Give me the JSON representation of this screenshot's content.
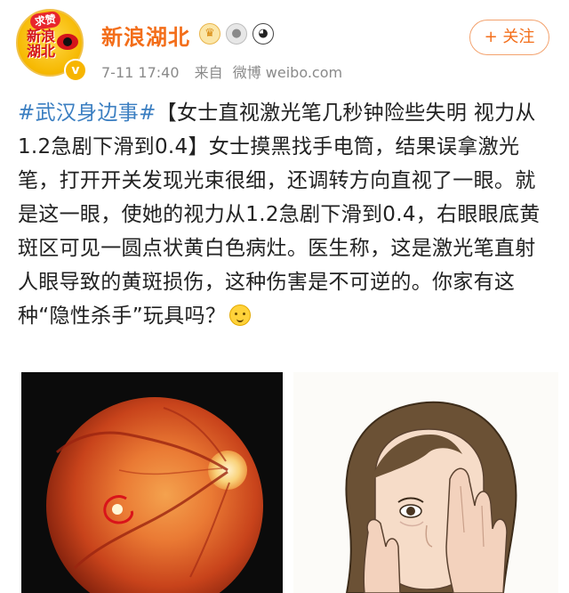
{
  "account": {
    "name": "新浪湖北",
    "avatar_badge": "求赞",
    "avatar_text": "新浪湖北",
    "verified_icon": "v",
    "badge_icons": [
      "crown-icon",
      "medal-icon",
      "panda-icon"
    ]
  },
  "meta": {
    "date": "7-11 17:40",
    "source_prefix": "来自",
    "source": "微博 weibo.com"
  },
  "follow_label": "+ 关注",
  "post": {
    "hashtag": "#武汉身边事#",
    "body": "【女士直视激光笔几秒钟险些失明 视力从1.2急剧下滑到0.4】女士摸黑找手电筒，结果误拿激光笔，打开开关发现光束很细，还调转方向直视了一眼。就是这一眼，使她的视力从1.2急剧下滑到0.4，右眼眼底黄斑区可见一圆点状黄白色病灶。医生称，这是激光笔直射人眼导致的黄斑损伤，这种伤害是不可逆的。你家有这种“隐性杀手”玩具吗？"
  },
  "images": {
    "retina": "retina-fundus-photo",
    "illustration": "woman-covering-eye-illustration"
  },
  "colors": {
    "username": "#f36e1a",
    "hashtag": "#3a7ec1",
    "meta": "#8a8a8a",
    "follow_border": "#f3a26e"
  }
}
